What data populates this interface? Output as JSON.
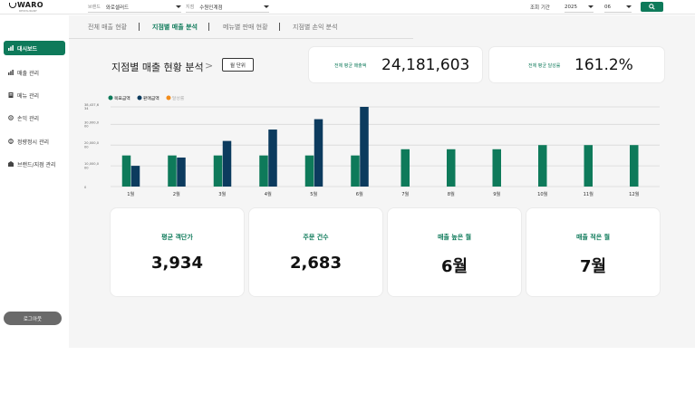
{
  "brand": {
    "logo_text": "WARO",
    "logo_sub": "RESTAURANT"
  },
  "header": {
    "brand_select": {
      "label": "브랜드",
      "value": "와로셀러드"
    },
    "store_select": {
      "label": "지점",
      "value": "수원인계점"
    },
    "period_label": "조회 기간",
    "year": "2025",
    "month": "06"
  },
  "sidebar": {
    "items": [
      {
        "label": "대시보드",
        "icon": "chart-icon"
      },
      {
        "label": "매출 관리",
        "icon": "bar-icon"
      },
      {
        "label": "메뉴 관리",
        "icon": "menu-book-icon"
      },
      {
        "label": "손익 관리",
        "icon": "gear-icon"
      },
      {
        "label": "정량정시 관리",
        "icon": "settings-icon"
      },
      {
        "label": "브랜드/지점 관리",
        "icon": "store-icon"
      }
    ],
    "logout_label": "로그아웃"
  },
  "tabs": [
    {
      "label": "전체 매출 현황"
    },
    {
      "label": "지점별 매출 분석"
    },
    {
      "label": "메뉴별 판매 현황"
    },
    {
      "label": "지점별 손익 분석"
    }
  ],
  "page": {
    "title": "지점별 매출 현황 분석",
    "title_arrow": ">",
    "unit_button": "월 단위"
  },
  "kpis_top": [
    {
      "label": "전체 평균 매출액",
      "value": "24,181,603"
    },
    {
      "label": "전체 평균 달성률",
      "value": "161.2%"
    }
  ],
  "chart_data": {
    "type": "bar",
    "legend": [
      "목표금액",
      "판매금액",
      "달성률"
    ],
    "legend_colors": [
      "#0e7a5a",
      "#0c3b5e",
      "#f28c1b"
    ],
    "categories": [
      "1월",
      "2월",
      "3월",
      "4월",
      "5월",
      "6월",
      "7월",
      "8월",
      "9월",
      "10월",
      "11월",
      "12월"
    ],
    "y_ticks": [
      "0",
      "10,000,0\n00",
      "20,000,0\n00",
      "30,000,0\n00",
      "38,437,6\n34"
    ],
    "ylim": [
      0,
      38437634
    ],
    "series": [
      {
        "name": "목표금액",
        "color": "#0e7a5a",
        "values": [
          15000000,
          15000000,
          15000000,
          15000000,
          15000000,
          15000000,
          18000000,
          18000000,
          18000000,
          20000000,
          20000000,
          20000000
        ]
      },
      {
        "name": "판매금액",
        "color": "#0c3b5e",
        "values": [
          10000000,
          14000000,
          22000000,
          27500000,
          32500000,
          38437634,
          null,
          null,
          null,
          null,
          null,
          null
        ]
      }
    ]
  },
  "cards": [
    {
      "label": "평균 객단가",
      "value": "3,934"
    },
    {
      "label": "주문 건수",
      "value": "2,683"
    },
    {
      "label": "매출 높은 월",
      "value": "6월"
    },
    {
      "label": "매출 적은 월",
      "value": "7월"
    }
  ]
}
